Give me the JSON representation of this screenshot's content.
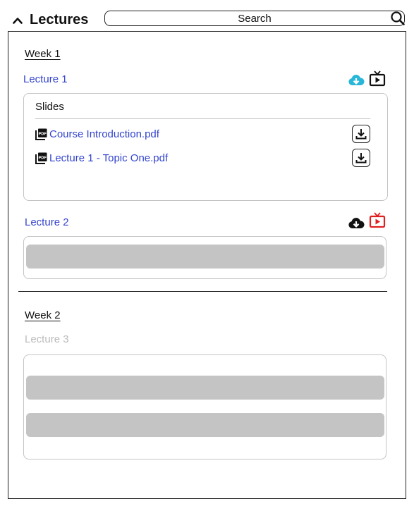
{
  "header": {
    "title": "Lectures",
    "search_placeholder": "Search"
  },
  "weeks": [
    {
      "label": "Week 1",
      "lectures": [
        {
          "label": "Lecture 1",
          "cloud_color": "#29b6d8",
          "tv_color": "#111111",
          "section": {
            "heading": "Slides",
            "files": [
              {
                "name": "Course Introduction.pdf"
              },
              {
                "name": "Lecture 1 - Topic One.pdf"
              }
            ]
          }
        },
        {
          "label": "Lecture 2",
          "cloud_color": "#111111",
          "tv_color": "#e02020"
        }
      ]
    },
    {
      "label": "Week 2",
      "lectures": [
        {
          "label": "Lecture 3",
          "disabled": true
        }
      ]
    }
  ],
  "colors": {
    "link": "#3344cc",
    "disabled_text": "#bbbbbb",
    "placeholder": "#c4c4c4"
  },
  "icons": {
    "collapse": "chevron-up-icon",
    "search": "search-icon",
    "cloud_download": "cloud-download-icon",
    "video": "tv-play-icon",
    "pdf": "pdf-file-icon",
    "download": "download-icon"
  }
}
